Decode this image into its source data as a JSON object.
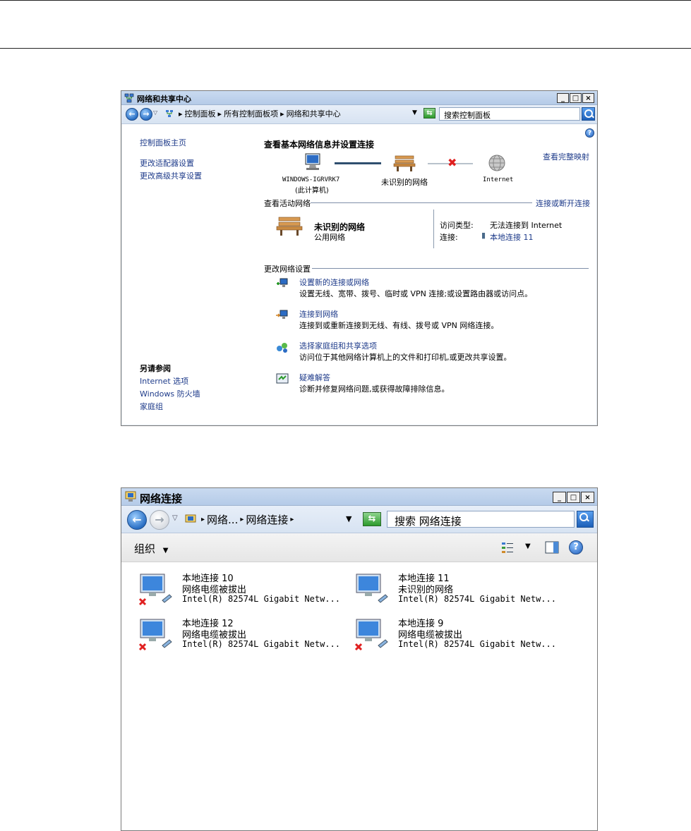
{
  "win1": {
    "title": "网络和共享中心",
    "breadcrumb": [
      "控制面板",
      "所有控制面板项",
      "网络和共享中心"
    ],
    "search_placeholder": "搜索控制面板",
    "left_nav": {
      "home": "控制面板主页",
      "adapter": "更改适配器设置",
      "advanced": "更改高级共享设置",
      "see_also_title": "另请参阅",
      "see_also": [
        "Internet 选项",
        "Windows 防火墙",
        "家庭组"
      ]
    },
    "heading": "查看基本网络信息并设置连接",
    "view_full_map": "查看完整映射",
    "map": {
      "computer_name": "WINDOWS-IGRVRK7",
      "computer_sub": "(此计算机)",
      "network": "未识别的网络",
      "internet": "Internet"
    },
    "active_section": "查看活动网络",
    "connect_disconnect": "连接或断开连接",
    "active_network": {
      "name": "未识别的网络",
      "type": "公用网络",
      "access_label": "访问类型:",
      "access_value": "无法连接到 Internet",
      "conn_label": "连接:",
      "conn_value": "本地连接 11"
    },
    "change_section": "更改网络设置",
    "tasks": [
      {
        "title": "设置新的连接或网络",
        "desc": "设置无线、宽带、拨号、临时或 VPN 连接;或设置路由器或访问点。"
      },
      {
        "title": "连接到网络",
        "desc": "连接到或重新连接到无线、有线、拨号或 VPN 网络连接。"
      },
      {
        "title": "选择家庭组和共享选项",
        "desc": "访问位于其他网络计算机上的文件和打印机,或更改共享设置。"
      },
      {
        "title": "疑难解答",
        "desc": "诊断并修复网络问题,或获得故障排除信息。"
      }
    ]
  },
  "win2": {
    "title": "网络连接",
    "breadcrumb": [
      "网络...",
      "网络连接"
    ],
    "search_placeholder": "搜索 网络连接",
    "organize": "组织",
    "connections": [
      {
        "name": "本地连接 10",
        "status": "网络电缆被拔出",
        "device": "Intel(R) 82574L Gigabit Netw...",
        "error": true
      },
      {
        "name": "本地连接 11",
        "status": "未识别的网络",
        "device": "Intel(R) 82574L Gigabit Netw...",
        "error": false
      },
      {
        "name": "本地连接 12",
        "status": "网络电缆被拔出",
        "device": "Intel(R) 82574L Gigabit Netw...",
        "error": true
      },
      {
        "name": "本地连接 9",
        "status": "网络电缆被拔出",
        "device": "Intel(R) 82574L Gigabit Netw...",
        "error": true
      }
    ]
  }
}
